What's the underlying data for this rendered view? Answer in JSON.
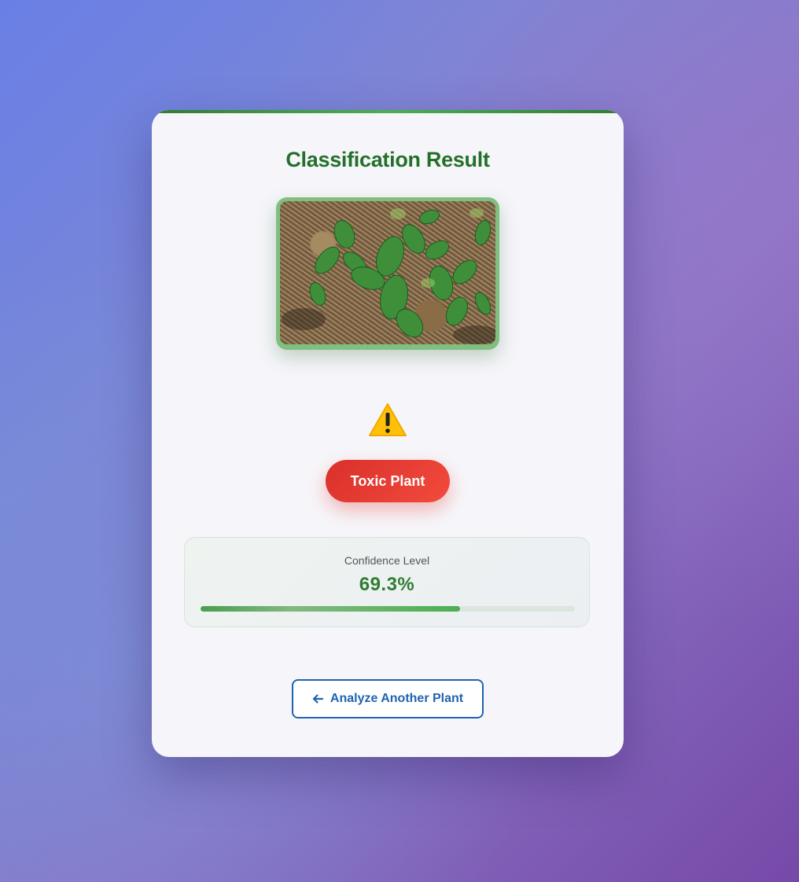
{
  "page": {
    "title": "Classification Result"
  },
  "result": {
    "image_alt": "Uploaded plant photo",
    "warning_icon": "warning-icon",
    "label": "Toxic Plant",
    "label_color": "#e53935"
  },
  "confidence": {
    "label": "Confidence Level",
    "value_text": "69.3%",
    "value": 69.3,
    "bar_color": "#4caf50"
  },
  "actions": {
    "analyze_again_icon": "arrow-left-icon",
    "analyze_again_label": "Analyze Another Plant"
  },
  "colors": {
    "accent_green": "#2f7d32",
    "toxic_red": "#e53935",
    "link_blue": "#1f63b0"
  }
}
